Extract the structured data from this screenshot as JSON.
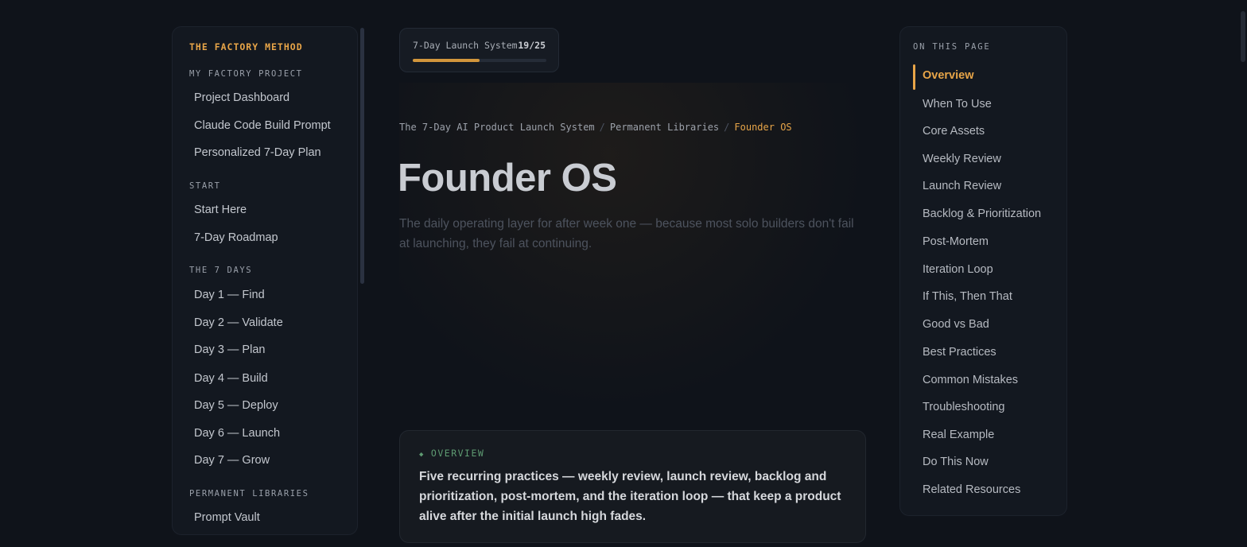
{
  "sidebar": {
    "brand": "THE FACTORY METHOD",
    "sections": [
      {
        "title": "MY FACTORY PROJECT",
        "items": [
          "Project Dashboard",
          "Claude Code Build Prompt",
          "Personalized 7-Day Plan"
        ]
      },
      {
        "title": "START",
        "items": [
          "Start Here",
          "7-Day Roadmap"
        ]
      },
      {
        "title": "THE 7 DAYS",
        "items": [
          "Day 1 — Find",
          "Day 2 — Validate",
          "Day 3 — Plan",
          "Day 4 — Build",
          "Day 5 — Deploy",
          "Day 6 — Launch",
          "Day 7 — Grow"
        ]
      },
      {
        "title": "PERMANENT LIBRARIES",
        "items": [
          "Prompt Vault"
        ]
      }
    ]
  },
  "progress": {
    "label": "7-Day Launch System",
    "count": "19/25",
    "fraction": 0.5
  },
  "breadcrumb": {
    "items": [
      "The 7-Day AI Product Launch System",
      "Permanent Libraries"
    ],
    "separator": "/",
    "current": "Founder OS"
  },
  "page": {
    "title": "Founder OS",
    "subtitle": "The daily operating layer for after week one — because most solo builders don't fail at launching, they fail at continuing."
  },
  "overview": {
    "label": "OVERVIEW",
    "icon": "diamond-icon",
    "text": "Five recurring practices — weekly review, launch review, backlog and prioritization, post-mortem, and the iteration loop — that keep a product alive after the initial launch high fades."
  },
  "toc": {
    "title": "ON THIS PAGE",
    "active_index": 0,
    "items": [
      "Overview",
      "When To Use",
      "Core Assets",
      "Weekly Review",
      "Launch Review",
      "Backlog & Prioritization",
      "Post-Mortem",
      "Iteration Loop",
      "If This, Then That",
      "Good vs Bad",
      "Best Practices",
      "Common Mistakes",
      "Troubleshooting",
      "Real Example",
      "Do This Now",
      "Related Resources"
    ]
  },
  "colors": {
    "accent": "#e8a548",
    "overview_accent": "#5e9b72",
    "background": "#0f131a"
  }
}
